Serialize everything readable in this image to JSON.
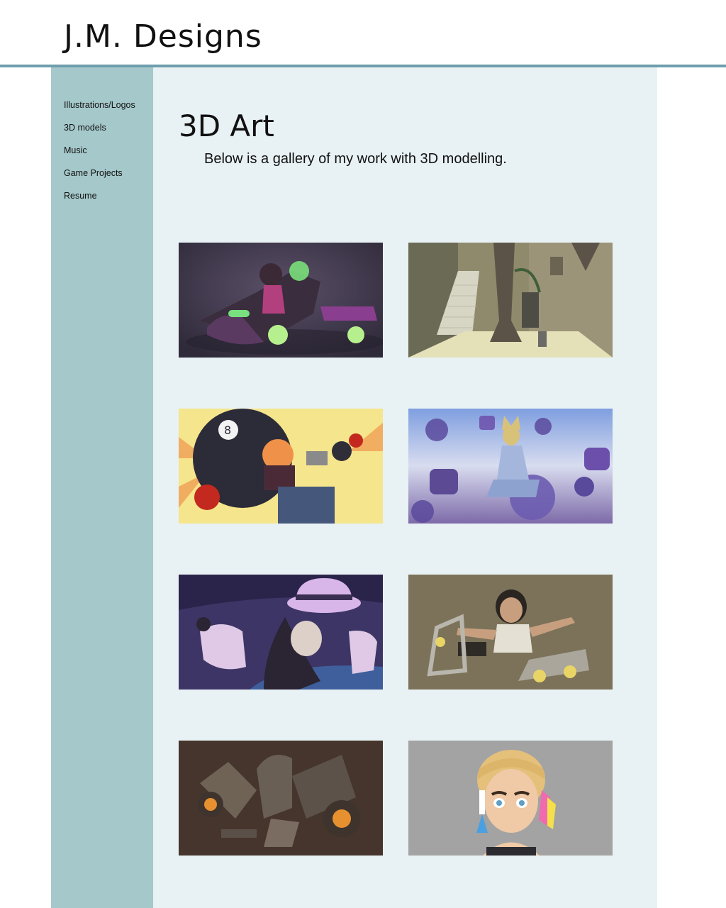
{
  "header": {
    "site_title": "J.M. Designs"
  },
  "sidebar": {
    "items": [
      {
        "label": "Illustrations/Logos"
      },
      {
        "label": "3D models"
      },
      {
        "label": "Music"
      },
      {
        "label": "Game Projects"
      },
      {
        "label": "Resume"
      }
    ]
  },
  "main": {
    "title": "3D Art",
    "intro": "Below is a gallery of my work with 3D modelling.",
    "gallery": [
      {
        "subject": "character-on-hover-bike",
        "bg_color": "#4a4158"
      },
      {
        "subject": "alley-stairs-scene",
        "bg_color": "#8a8466"
      },
      {
        "subject": "comic-8-ball-characters",
        "bg_color": "#f3e08a"
      },
      {
        "subject": "cat-robot-on-bubbles",
        "bg_color": "#a8b8e4"
      },
      {
        "subject": "hat-character-closeup",
        "bg_color": "#3d3566"
      },
      {
        "subject": "skater-girl-pose",
        "bg_color": "#7b7259"
      },
      {
        "subject": "robot-creature-dark",
        "bg_color": "#45352c"
      },
      {
        "subject": "girl-portrait-hairclips",
        "bg_color": "#a3a3a3"
      }
    ]
  },
  "colors": {
    "header_rule": "#6f9eae",
    "sidebar_bg": "#a5c8ca",
    "main_bg": "#e8f1f3"
  }
}
